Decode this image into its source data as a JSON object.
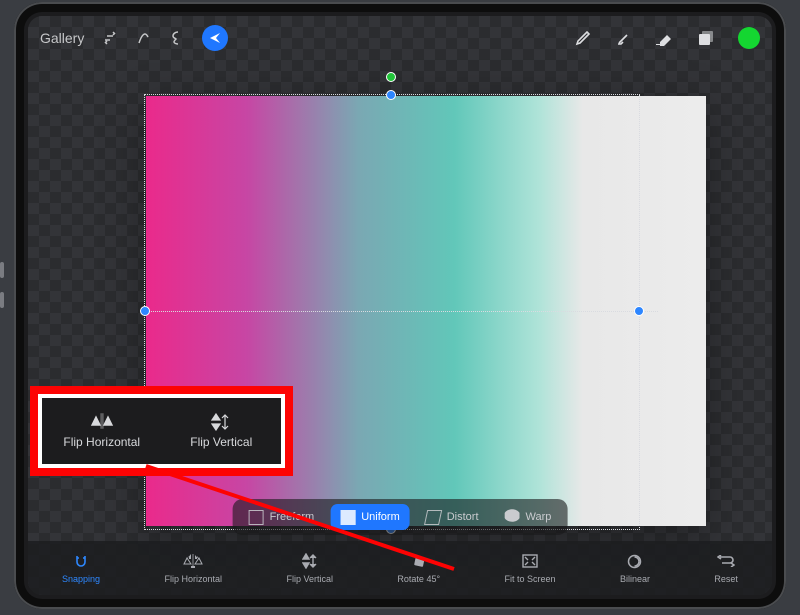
{
  "topbar": {
    "gallery_label": "Gallery"
  },
  "mode": {
    "freeform": "Freeform",
    "uniform": "Uniform",
    "distort": "Distort",
    "warp": "Warp"
  },
  "actions": {
    "snapping": "Snapping",
    "flip_h": "Flip Horizontal",
    "flip_v": "Flip Vertical",
    "rotate": "Rotate 45°",
    "fit": "Fit to Screen",
    "bilinear": "Bilinear",
    "reset": "Reset"
  },
  "callout": {
    "flip_h": "Flip Horizontal",
    "flip_v": "Flip Vertical"
  },
  "colors": {
    "accent": "#1f77ff",
    "swatch": "#14d631",
    "highlight": "#fd0303"
  }
}
